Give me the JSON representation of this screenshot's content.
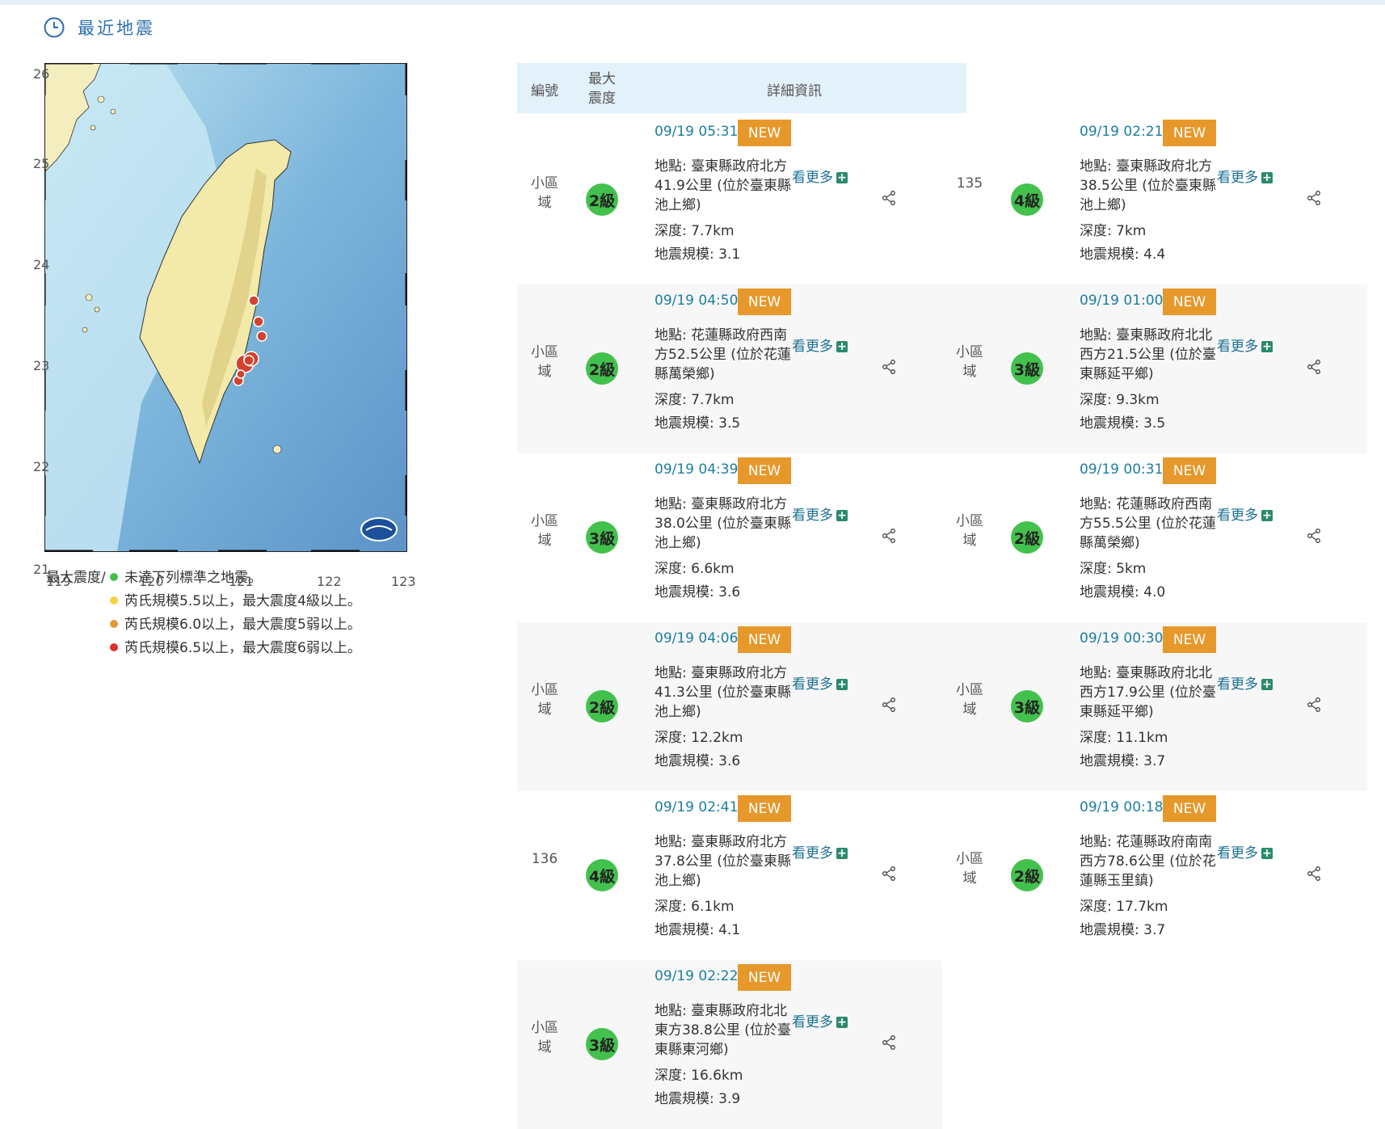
{
  "section": {
    "title": "最近地震"
  },
  "map": {
    "lat_labels": [
      "26",
      "25",
      "24",
      "23",
      "22",
      "21"
    ],
    "lon_labels": [
      "119",
      "120",
      "121",
      "122",
      "123"
    ]
  },
  "legend": {
    "title": "最大震度/",
    "items": [
      {
        "text": "未達下列標準之地震。",
        "color": "#43c14d"
      },
      {
        "text": "芮氏規模5.5以上，最大震度4級以上。",
        "color": "#f5d142"
      },
      {
        "text": "芮氏規模6.0以上，最大震度5弱以上。",
        "color": "#e69a3a"
      },
      {
        "text": "芮氏規模6.5以上，最大震度6弱以上。",
        "color": "#e0302a"
      }
    ]
  },
  "table": {
    "headers": {
      "id": "編號",
      "intensity": "最大震度",
      "detail": "詳細資訊"
    },
    "more_label": "看更多",
    "new_label": "NEW",
    "quakes": [
      {
        "id": "小區域",
        "intensity": "2級",
        "time": "09/19 05:31",
        "location": "地點: 臺東縣政府北方41.9公里 (位於臺東縣池上鄉)",
        "depth": "深度: 7.7km",
        "magnitude": "地震規模: 3.1"
      },
      {
        "id": "135",
        "intensity": "4級",
        "time": "09/19 02:21",
        "location": "地點: 臺東縣政府北方38.5公里 (位於臺東縣池上鄉)",
        "depth": "深度: 7km",
        "magnitude": "地震規模: 4.4"
      },
      {
        "id": "小區域",
        "intensity": "2級",
        "time": "09/19 04:50",
        "location": "地點: 花蓮縣政府西南方52.5公里 (位於花蓮縣萬榮鄉)",
        "depth": "深度: 7.7km",
        "magnitude": "地震規模: 3.5"
      },
      {
        "id": "小區域",
        "intensity": "3級",
        "time": "09/19 01:00",
        "location": "地點: 臺東縣政府北北西方21.5公里 (位於臺東縣延平鄉)",
        "depth": "深度: 9.3km",
        "magnitude": "地震規模: 3.5"
      },
      {
        "id": "小區域",
        "intensity": "3級",
        "time": "09/19 04:39",
        "location": "地點: 臺東縣政府北方38.0公里 (位於臺東縣池上鄉)",
        "depth": "深度: 6.6km",
        "magnitude": "地震規模: 3.6"
      },
      {
        "id": "小區域",
        "intensity": "2級",
        "time": "09/19 00:31",
        "location": "地點: 花蓮縣政府西南方55.5公里 (位於花蓮縣萬榮鄉)",
        "depth": "深度: 5km",
        "magnitude": "地震規模: 4.0"
      },
      {
        "id": "小區域",
        "intensity": "2級",
        "time": "09/19 04:06",
        "location": "地點: 臺東縣政府北方41.3公里 (位於臺東縣池上鄉)",
        "depth": "深度: 12.2km",
        "magnitude": "地震規模: 3.6"
      },
      {
        "id": "小區域",
        "intensity": "3級",
        "time": "09/19 00:30",
        "location": "地點: 臺東縣政府北北西方17.9公里 (位於臺東縣延平鄉)",
        "depth": "深度: 11.1km",
        "magnitude": "地震規模: 3.7"
      },
      {
        "id": "136",
        "intensity": "4級",
        "time": "09/19 02:41",
        "location": "地點: 臺東縣政府北方37.8公里 (位於臺東縣池上鄉)",
        "depth": "深度: 6.1km",
        "magnitude": "地震規模: 4.1"
      },
      {
        "id": "小區域",
        "intensity": "2級",
        "time": "09/19 00:18",
        "location": "地點: 花蓮縣政府南南西方78.6公里 (位於花蓮縣玉里鎮)",
        "depth": "深度: 17.7km",
        "magnitude": "地震規模: 3.7"
      },
      {
        "id": "小區域",
        "intensity": "3級",
        "time": "09/19 02:22",
        "location": "地點: 臺東縣政府北北東方38.8公里 (位於臺東縣東河鄉)",
        "depth": "深度: 16.6km",
        "magnitude": "地震規模: 3.9"
      }
    ]
  }
}
